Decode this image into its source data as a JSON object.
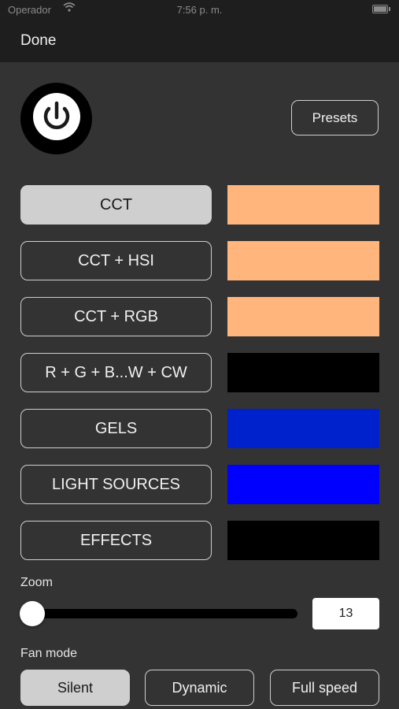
{
  "status_bar": {
    "carrier": "Operador",
    "time": "7:56 p. m."
  },
  "nav": {
    "done_label": "Done"
  },
  "presets_label": "Presets",
  "modes": [
    {
      "label": "CCT",
      "selected": true,
      "color": "#ffb57c"
    },
    {
      "label": "CCT + HSI",
      "selected": false,
      "color": "#ffb57c"
    },
    {
      "label": "CCT + RGB",
      "selected": false,
      "color": "#ffb57c"
    },
    {
      "label": "R + G + B...W + CW",
      "selected": false,
      "color": "#000000"
    },
    {
      "label": "GELS",
      "selected": false,
      "color": "#0022cc"
    },
    {
      "label": "LIGHT SOURCES",
      "selected": false,
      "color": "#0000ff"
    },
    {
      "label": "EFFECTS",
      "selected": false,
      "color": "#000000"
    }
  ],
  "zoom": {
    "label": "Zoom",
    "value": "13"
  },
  "fan": {
    "label": "Fan mode",
    "options": [
      "Silent",
      "Dynamic",
      "Full speed"
    ],
    "selected": "Silent"
  },
  "icons": {
    "power": "power-icon",
    "wifi": "wifi-icon",
    "battery": "battery-icon"
  }
}
